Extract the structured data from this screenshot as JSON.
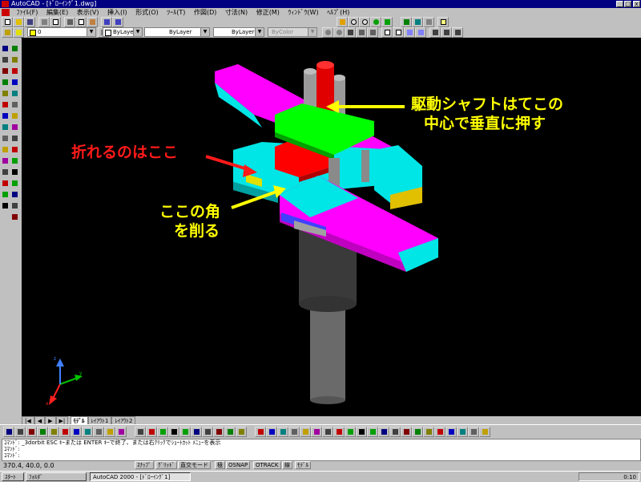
{
  "window": {
    "title": "AutoCAD - [ﾄﾞﾛｰｲﾝｸﾞ1.dwg]",
    "minimize": "_",
    "maximize": "□",
    "close": "x"
  },
  "menu": {
    "items": [
      "ﾌｧｲﾙ(F)",
      "編集(E)",
      "表示(V)",
      "挿入(I)",
      "形式(O)",
      "ﾂｰﾙ(T)",
      "作図(D)",
      "寸法(N)",
      "修正(M)",
      "ｳｨﾝﾄﾞｳ(W)",
      "ﾍﾙﾌﾟ(H)"
    ]
  },
  "layers": {
    "layer_combo": "0",
    "color_combo": "ByLayer",
    "linetype_combo": "ByLayer",
    "lineweight_combo": "ByLayer",
    "plotstyle_combo": "ByColor"
  },
  "annotations": {
    "drive_shaft_line1": "駆動シャフトはてこの",
    "drive_shaft_line2": "中心で垂直に押す",
    "breaks_here": "折れるのはここ",
    "cut_corner_line1": "ここの角",
    "cut_corner_line2": "を削る"
  },
  "layout_tabs": [
    "ﾓﾃﾞﾙ",
    "ﾚｲｱｳﾄ1",
    "ﾚｲｱｳﾄ2"
  ],
  "command_lines": [
    "ｺﾏﾝﾄﾞ: _3dorbit ESC ｷｰまたは ENTER ｷｰで終了、または右ｸﾘｯｸでｼｮｰﾄｶｯﾄ ﾒﾆｭｰを表示",
    "ｺﾏﾝﾄﾞ:",
    "ｺﾏﾝﾄﾞ:"
  ],
  "status": {
    "coords": "370.4, 40.0, 0.0",
    "toggles": [
      "ｽﾅｯﾌﾟ",
      "ｸﾞﾘｯﾄﾞ",
      "直交モード",
      "極",
      "OSNAP",
      "OTRACK",
      "線",
      "ﾓﾃﾞﾙ"
    ]
  },
  "taskbar": {
    "start": "ｽﾀｰﾄ",
    "tasks": [
      "ﾌｫﾙﾀﾞ",
      "AutoCAD 2000 - [ﾄﾞﾛｰｲﾝｸﾞ1]"
    ],
    "clock": "0:10"
  },
  "colors": {
    "canvas": "#000000",
    "annotation_yellow": "#ffff00",
    "annotation_red": "#ff1a1a",
    "lever_magenta": "#ff00ff",
    "block_cyan": "#00e5e5",
    "plate_green": "#00ff00",
    "part_red": "#ff0000",
    "shaft_gray": "#6a6a6a"
  },
  "icons": [
    "new-icon",
    "open-icon",
    "save-icon",
    "print-icon",
    "preview-icon",
    "cut-icon",
    "copy-icon",
    "paste-icon",
    "undo-icon",
    "redo-icon",
    "pan-icon",
    "zoom-icon",
    "3dorbit-icon",
    "line-icon",
    "circle-icon",
    "ucs-icon"
  ]
}
